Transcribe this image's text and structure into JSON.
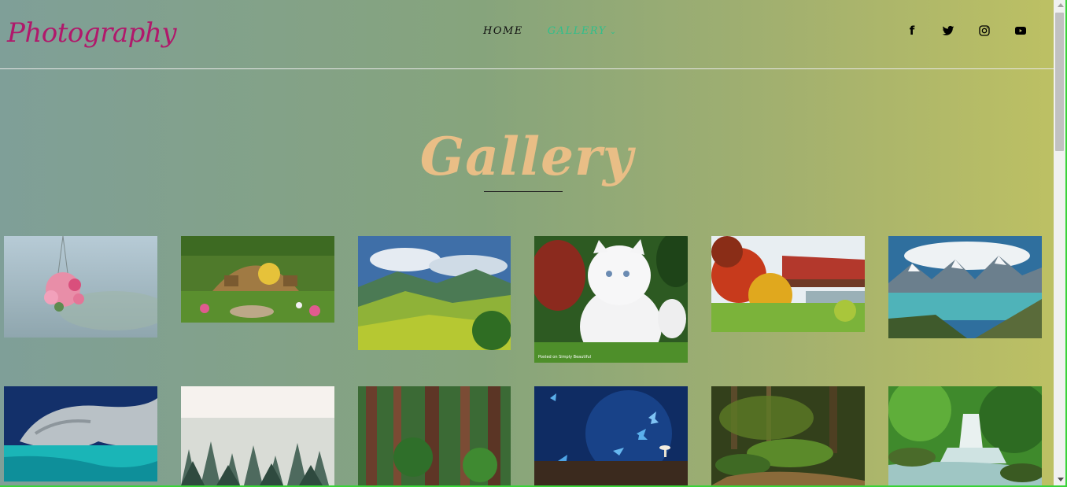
{
  "brand": {
    "logo": "Photography"
  },
  "nav": {
    "home": "HOME",
    "gallery": "GALLERY",
    "chevron": "⌄"
  },
  "social": {
    "facebook": "f",
    "twitter": "twitter-icon",
    "instagram": "instagram-icon",
    "youtube": "youtube-icon"
  },
  "page": {
    "title": "Gallery"
  },
  "gallery": {
    "images": [
      "hanging-flower-basket",
      "hobbit-house-garden",
      "green-valley-hills",
      "white-kitten",
      "red-covered-bridge-autumn",
      "mountain-lake",
      "marble-caves-turquoise-water",
      "misty-pine-forest",
      "redwood-forest",
      "blue-butterflies",
      "mossy-forest-stream",
      "forest-waterfall"
    ],
    "caption": "Posted on Simply Beautiful"
  },
  "colors": {
    "logo": "#b0196b",
    "nav_active": "#2fbf8b",
    "title": "#e9be86"
  }
}
